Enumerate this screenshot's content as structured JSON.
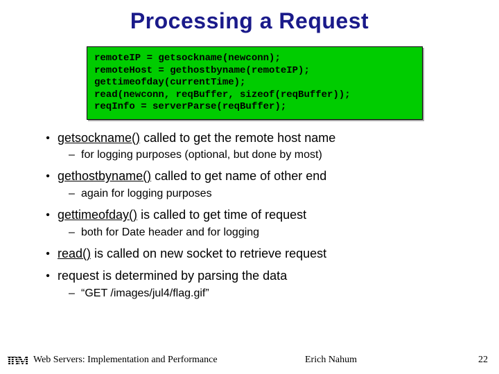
{
  "title": "Processing a Request",
  "code": "remoteIP = getsockname(newconn);\nremoteHost = gethostbyname(remoteIP);\ngettimeofday(currentTime);\nread(newconn, reqBuffer, sizeof(reqBuffer));\nreqInfo = serverParse(reqBuffer);",
  "b1_u": "getsockname()",
  "b1_rest": " called to get the remote host name",
  "s1": "for logging purposes (optional, but done by most)",
  "b2_u": "gethostbyname()",
  "b2_rest": " called to get name of other end",
  "s2": "again for logging purposes",
  "b3_u": "gettimeofday()",
  "b3_rest": " is called to get time of request",
  "s3": "both for Date header and for logging",
  "b4_u": "read()",
  "b4_rest": " is called on new socket to retrieve request",
  "b5": "request is determined by parsing the data",
  "s5": "“GET /images/jul4/flag.gif”",
  "footer_left": "Web Servers: Implementation and Performance",
  "footer_mid": "Erich Nahum",
  "footer_num": "22",
  "ibm": "IBM"
}
